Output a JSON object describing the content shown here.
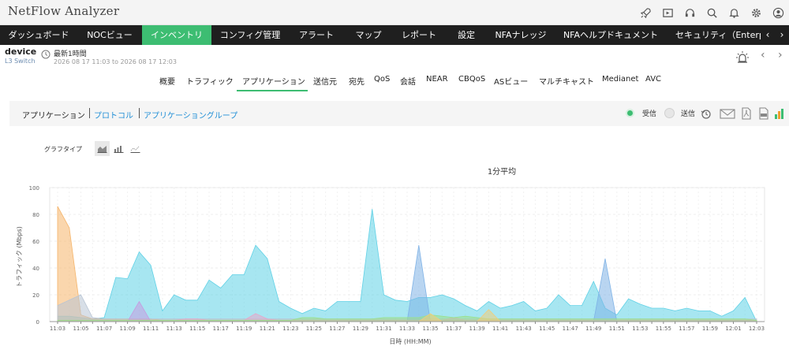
{
  "app": {
    "title": "NetFlow Analyzer"
  },
  "header_icons": [
    "rocket-icon",
    "media-icon",
    "headset-icon",
    "search-icon",
    "bell-icon",
    "gear-icon",
    "user-icon"
  ],
  "nav": {
    "items": [
      {
        "label": "ダッシュボード",
        "active": false
      },
      {
        "label": "NOCビュー",
        "active": false
      },
      {
        "label": "インベントリ",
        "active": true
      },
      {
        "label": "コンフィグ管理",
        "active": false
      },
      {
        "label": "アラート",
        "active": false
      },
      {
        "label": "マップ",
        "active": false
      },
      {
        "label": "レポート",
        "active": false
      },
      {
        "label": "設定",
        "active": false
      },
      {
        "label": "NFAナレッジ",
        "active": false
      },
      {
        "label": "NFAヘルプドキュメント",
        "active": false
      },
      {
        "label": "セキュリティ（Enterpris",
        "active": false
      }
    ],
    "prev_arrow": "‹",
    "next_arrow": "›"
  },
  "device": {
    "name": "device",
    "type": "L3 Switch",
    "period_label": "最新1時間",
    "period_range": "2026 08 17 11:03 to 2026 08 17 12:03"
  },
  "subtabs": {
    "items": [
      "概要",
      "トラフィック",
      "アプリケーション",
      "送信元",
      "宛先",
      "QoS",
      "会話",
      "NEAR",
      "CBQoS",
      "ASビュー",
      "マルチキャスト",
      "Medianet",
      "AVC"
    ],
    "active_index": 2
  },
  "panel": {
    "tabs": [
      "アプリケーション",
      "プロトコル",
      "アプリケーショングループ"
    ],
    "active_index": 0,
    "legend_in": {
      "label": "受信",
      "color": "#3dbd72"
    },
    "legend_out": {
      "label": "送信",
      "color": "#e0e0e0"
    },
    "tools": [
      "history-icon",
      "mail-icon",
      "pdf-icon",
      "csv-icon",
      "bar-chart-icon"
    ]
  },
  "graph_type": {
    "label": "グラフタイプ",
    "buttons": [
      "area-chart-icon",
      "bar-chart-icon",
      "line-chart-icon"
    ],
    "active_index": 0
  },
  "chart_data": {
    "type": "area",
    "title": "1分平均",
    "xlabel": "日時 (HH:MM)",
    "ylabel": "トラフィック (Mbps)",
    "ylim": [
      0,
      100
    ],
    "yticks": [
      "0",
      "20",
      "40",
      "60",
      "80",
      "100"
    ],
    "x": [
      "11:03",
      "11:04",
      "11:05",
      "11:06",
      "11:07",
      "11:08",
      "11:09",
      "11:10",
      "11:11",
      "11:12",
      "11:13",
      "11:14",
      "11:15",
      "11:16",
      "11:17",
      "11:18",
      "11:19",
      "11:20",
      "11:21",
      "11:22",
      "11:23",
      "11:24",
      "11:25",
      "11:26",
      "11:27",
      "11:28",
      "11:29",
      "11:30",
      "11:31",
      "11:32",
      "11:33",
      "11:34",
      "11:35",
      "11:36",
      "11:37",
      "11:38",
      "11:39",
      "11:40",
      "11:41",
      "11:42",
      "11:43",
      "11:44",
      "11:45",
      "11:46",
      "11:47",
      "11:48",
      "11:49",
      "11:50",
      "11:51",
      "11:52",
      "11:53",
      "11:54",
      "11:55",
      "11:56",
      "11:57",
      "11:58",
      "11:59",
      "12:00",
      "12:01",
      "12:02",
      "12:03"
    ],
    "xtick_labels": [
      "11:03",
      "11:05",
      "11:07",
      "11:09",
      "11:11",
      "11:13",
      "11:15",
      "11:17",
      "11:19",
      "11:21",
      "11:23",
      "11:25",
      "11:27",
      "11:29",
      "11:31",
      "11:33",
      "11:35",
      "11:37",
      "11:39",
      "11:41",
      "11:43",
      "11:45",
      "11:47",
      "11:49",
      "11:51",
      "11:53",
      "11:55",
      "11:57",
      "11:59",
      "12:01",
      "12:03"
    ],
    "series": [
      {
        "color": "#5fd1e6",
        "values": [
          4,
          4,
          3,
          2,
          3,
          33,
          32,
          52,
          42,
          8,
          20,
          16,
          16,
          31,
          25,
          35,
          35,
          57,
          47,
          15,
          10,
          6,
          10,
          8,
          15,
          15,
          15,
          84,
          20,
          16,
          15,
          18,
          18,
          20,
          17,
          12,
          8,
          15,
          10,
          12,
          15,
          8,
          10,
          20,
          12,
          12,
          30,
          10,
          5,
          17,
          13,
          10,
          10,
          8,
          10,
          8,
          8,
          4,
          8,
          18,
          0
        ]
      },
      {
        "color": "#f5b46a",
        "values": [
          86,
          70,
          5,
          2,
          2,
          2,
          2,
          2,
          2,
          1,
          1,
          1,
          1,
          1,
          1,
          1,
          1,
          1,
          1,
          1,
          1,
          1,
          1,
          1,
          1,
          1,
          1,
          1,
          1,
          1,
          1,
          1,
          1,
          1,
          1,
          1,
          1,
          1,
          1,
          1,
          1,
          1,
          1,
          1,
          1,
          1,
          1,
          1,
          1,
          1,
          1,
          1,
          1,
          1,
          1,
          1,
          1,
          1,
          1,
          1,
          1
        ]
      },
      {
        "color": "#b8c4d4",
        "values": [
          12,
          16,
          20,
          3,
          2,
          2,
          2,
          2,
          2,
          2,
          2,
          2,
          2,
          2,
          2,
          2,
          2,
          2,
          2,
          2,
          2,
          2,
          2,
          2,
          2,
          2,
          2,
          2,
          2,
          2,
          2,
          2,
          2,
          2,
          2,
          2,
          2,
          2,
          2,
          2,
          2,
          2,
          2,
          2,
          2,
          2,
          2,
          2,
          2,
          2,
          2,
          2,
          2,
          2,
          2,
          2,
          2,
          2,
          2,
          2,
          2
        ]
      },
      {
        "color": "#7fb2e6",
        "values": [
          0,
          0,
          0,
          0,
          0,
          0,
          0,
          0,
          0,
          0,
          0,
          0,
          0,
          0,
          0,
          0,
          0,
          0,
          0,
          0,
          0,
          0,
          0,
          0,
          0,
          0,
          0,
          0,
          0,
          0,
          0,
          57,
          0,
          0,
          0,
          0,
          0,
          0,
          0,
          0,
          0,
          0,
          0,
          0,
          0,
          0,
          0,
          47,
          0,
          0,
          0,
          0,
          0,
          0,
          0,
          0,
          0,
          0,
          0,
          0,
          0
        ]
      },
      {
        "color": "#c79be0",
        "values": [
          0,
          0,
          0,
          0,
          0,
          0,
          0,
          15,
          0,
          0,
          0,
          0,
          0,
          0,
          0,
          0,
          0,
          0,
          0,
          0,
          0,
          0,
          0,
          0,
          0,
          0,
          0,
          0,
          0,
          0,
          0,
          0,
          0,
          0,
          0,
          0,
          0,
          0,
          0,
          0,
          0,
          0,
          0,
          0,
          0,
          0,
          0,
          0,
          0,
          0,
          0,
          0,
          0,
          0,
          0,
          0,
          0,
          0,
          0,
          0,
          0
        ]
      },
      {
        "color": "#e9a5c8",
        "values": [
          1,
          1,
          1,
          1,
          1,
          1,
          1,
          1,
          1,
          1,
          1,
          2,
          2,
          1,
          1,
          1,
          1,
          6,
          2,
          1,
          1,
          1,
          1,
          1,
          1,
          1,
          1,
          1,
          1,
          1,
          1,
          1,
          1,
          1,
          3,
          1,
          1,
          1,
          1,
          1,
          1,
          1,
          1,
          1,
          1,
          1,
          1,
          1,
          1,
          1,
          1,
          1,
          1,
          1,
          1,
          1,
          1,
          1,
          1,
          1,
          1
        ]
      },
      {
        "color": "#9be08a",
        "values": [
          1,
          1,
          1,
          1,
          1,
          1,
          1,
          1,
          1,
          1,
          1,
          1,
          1,
          1,
          1,
          1,
          1,
          1,
          1,
          1,
          1,
          3,
          3,
          2,
          2,
          2,
          2,
          2,
          3,
          3,
          3,
          3,
          5,
          4,
          3,
          4,
          3,
          2,
          2,
          2,
          2,
          2,
          2,
          2,
          2,
          2,
          2,
          2,
          2,
          2,
          2,
          2,
          2,
          2,
          2,
          2,
          2,
          2,
          2,
          2,
          1
        ]
      },
      {
        "color": "#f2cd7a",
        "values": [
          0,
          0,
          0,
          0,
          0,
          0,
          0,
          0,
          0,
          0,
          0,
          0,
          0,
          0,
          0,
          0,
          0,
          0,
          0,
          0,
          0,
          0,
          0,
          0,
          0,
          0,
          0,
          0,
          0,
          0,
          0,
          0,
          6,
          0,
          0,
          0,
          0,
          9,
          0,
          0,
          0,
          0,
          0,
          0,
          0,
          0,
          0,
          0,
          0,
          0,
          0,
          0,
          0,
          0,
          0,
          0,
          0,
          0,
          0,
          0,
          0
        ]
      }
    ]
  }
}
